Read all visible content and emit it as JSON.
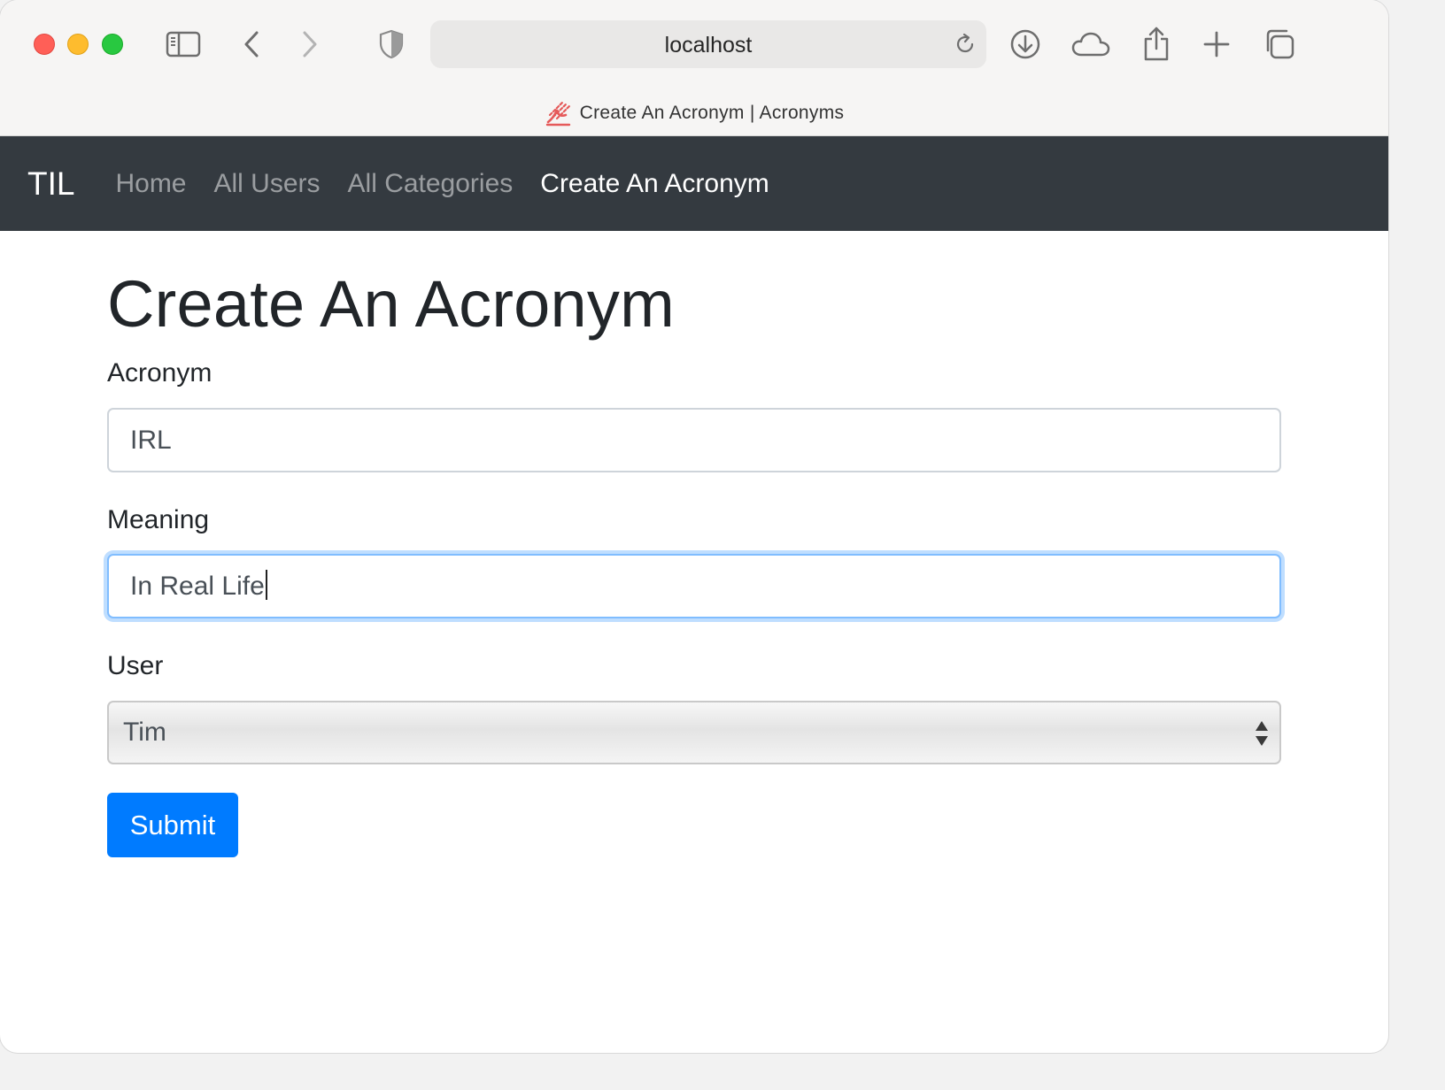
{
  "browser": {
    "url": "localhost",
    "tab_title": "Create An Acronym | Acronyms",
    "icons": [
      "sidebar-icon",
      "back-icon",
      "forward-icon",
      "shield-icon",
      "reload-icon",
      "download-icon",
      "cloud-icon",
      "share-icon",
      "new-tab-icon",
      "tabs-overview-icon"
    ]
  },
  "navbar": {
    "brand": "TIL",
    "links": [
      {
        "label": "Home",
        "active": false
      },
      {
        "label": "All Users",
        "active": false
      },
      {
        "label": "All Categories",
        "active": false
      },
      {
        "label": "Create An Acronym",
        "active": true
      }
    ]
  },
  "page": {
    "title": "Create An Acronym",
    "acronym_label": "Acronym",
    "acronym_value": "IRL",
    "meaning_label": "Meaning",
    "meaning_value": "In Real Life",
    "user_label": "User",
    "user_selected": "Tim",
    "submit_label": "Submit"
  },
  "colors": {
    "navbar_bg": "#343a40",
    "primary": "#007bff",
    "focus_ring": "#80bdff"
  }
}
